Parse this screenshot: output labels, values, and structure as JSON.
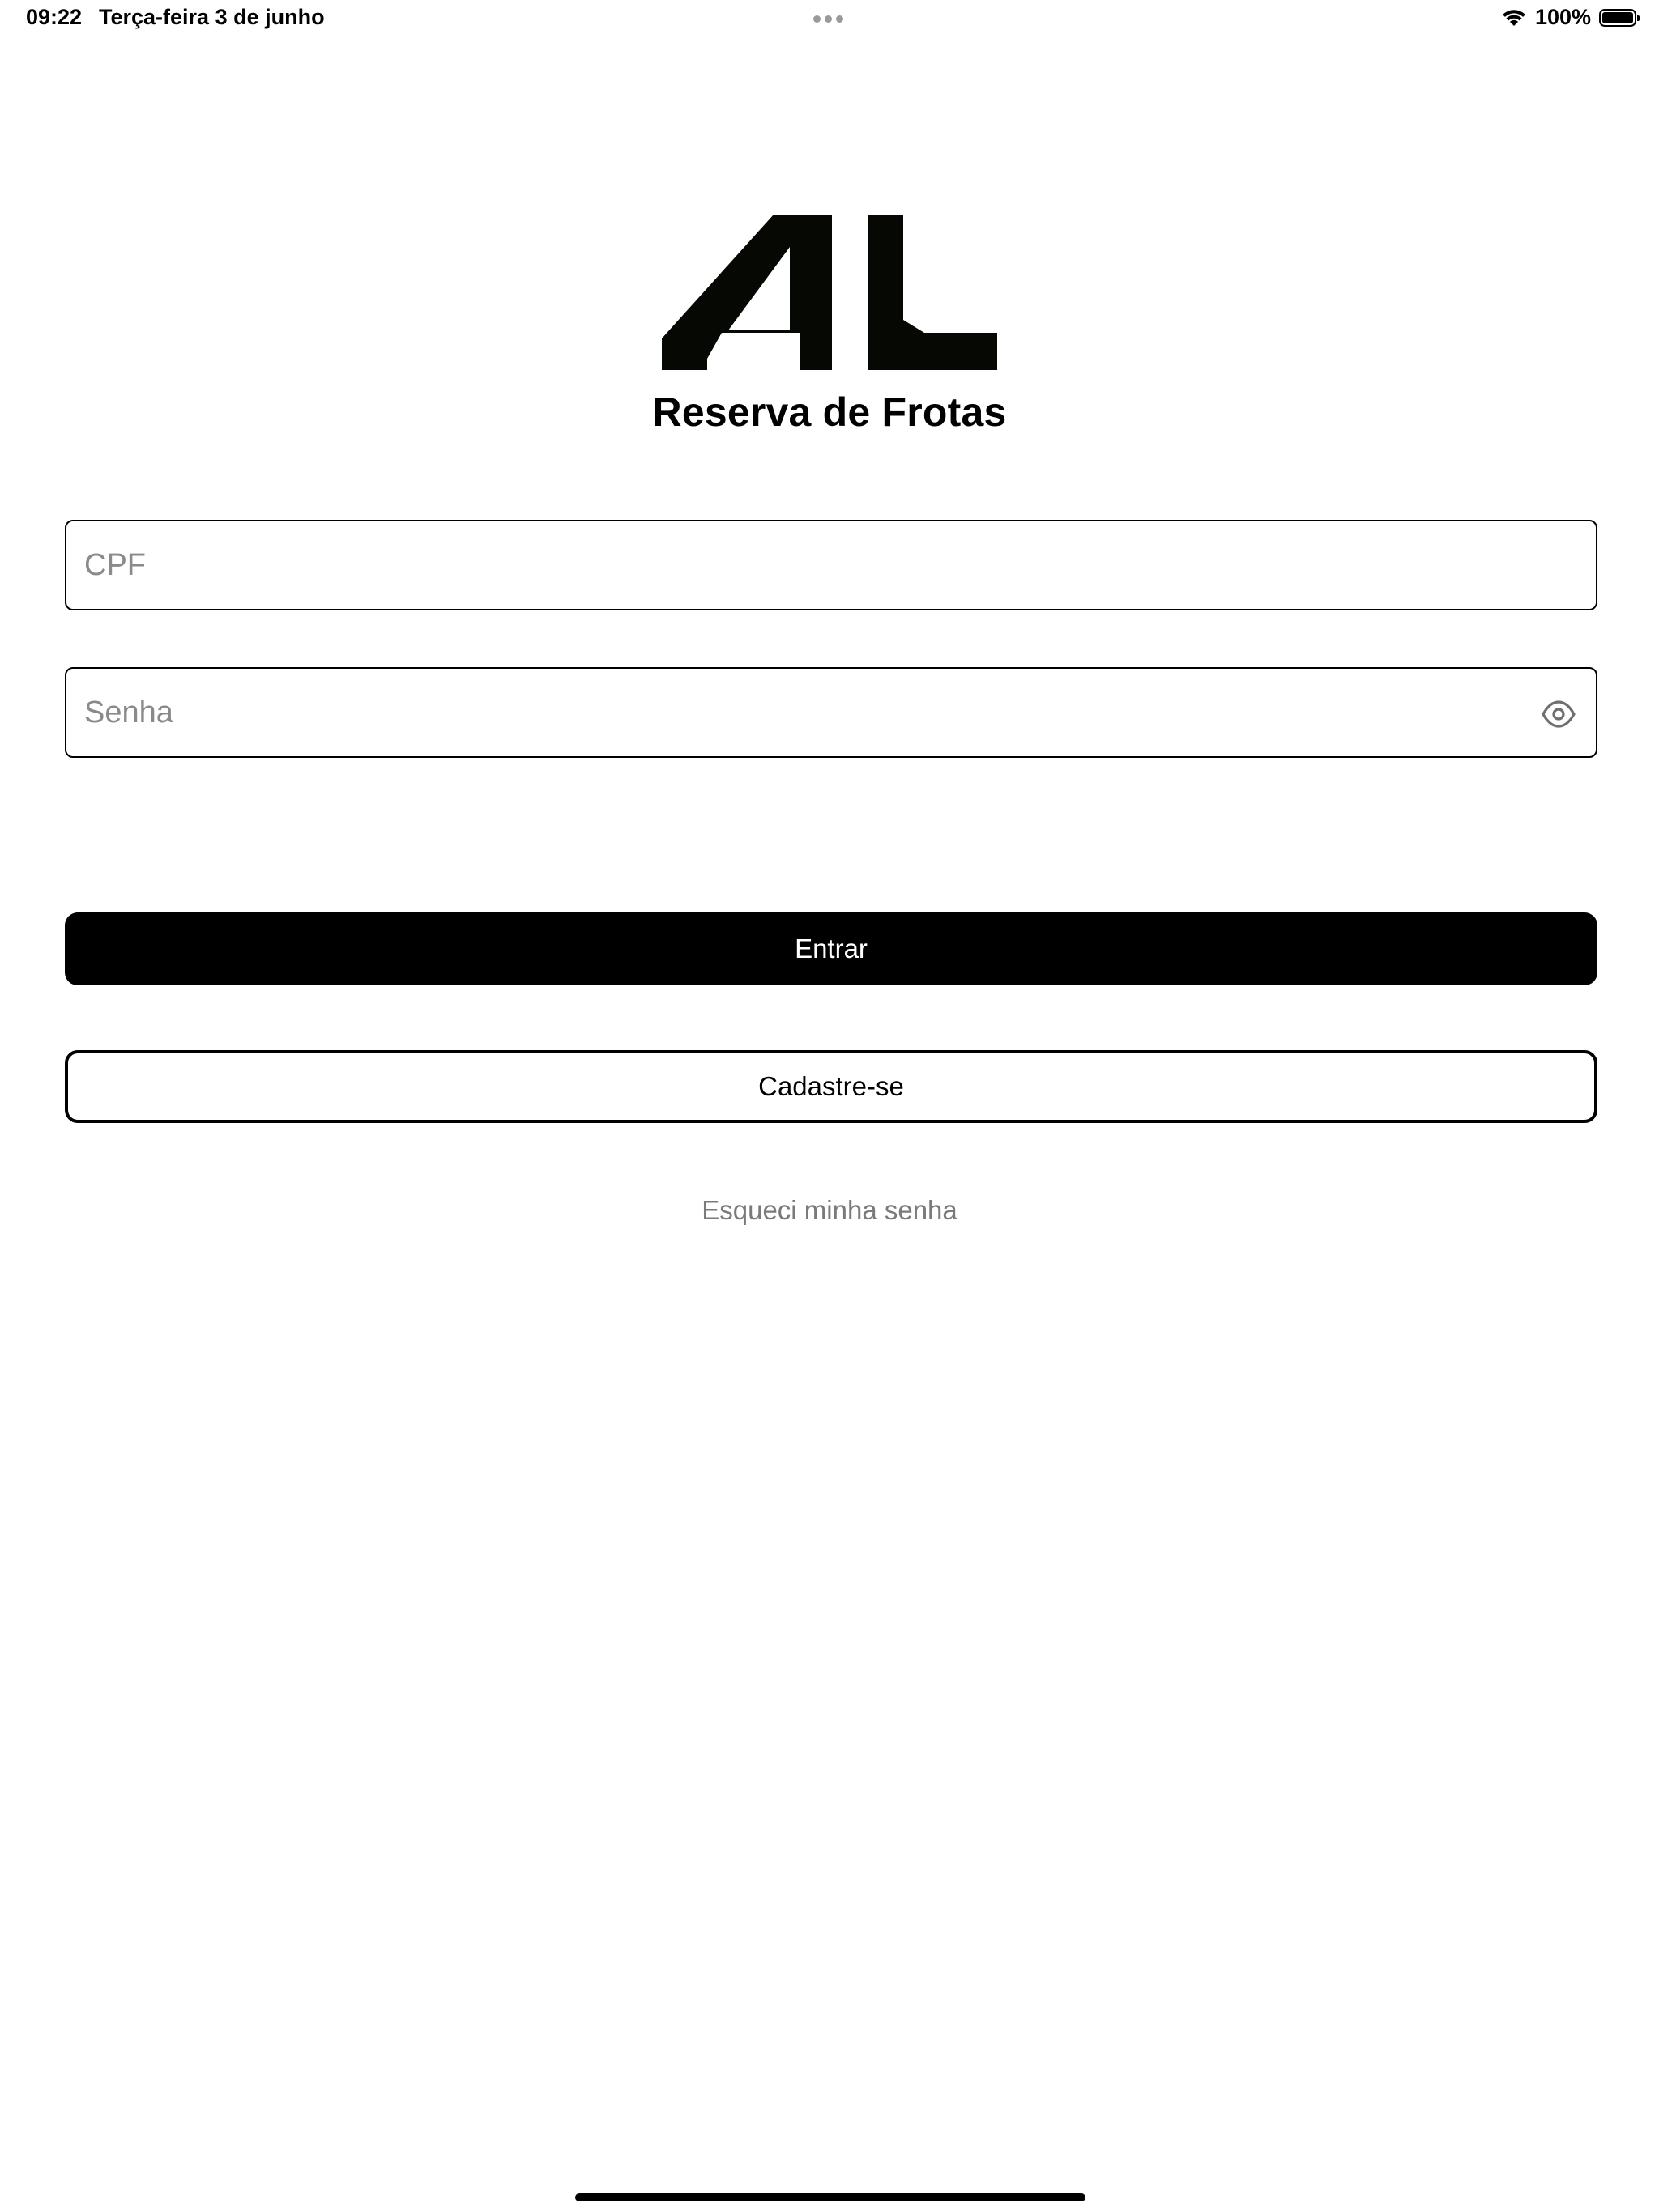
{
  "status_bar": {
    "time": "09:22",
    "date": "Terça-feira 3 de junho",
    "battery": "100%"
  },
  "brand": {
    "logo_text": "AL",
    "logo_color": "#060803",
    "app_title": "Reserva de Frotas"
  },
  "form": {
    "cpf": {
      "placeholder": "CPF",
      "value": ""
    },
    "senha": {
      "placeholder": "Senha",
      "value": ""
    }
  },
  "actions": {
    "login_label": "Entrar",
    "register_label": "Cadastre-se",
    "forgot_password_label": "Esqueci minha senha"
  },
  "icons": {
    "password_toggle": "eye-icon",
    "wifi": "wifi-icon",
    "battery": "battery-icon",
    "multitasking": "more-dots-icon"
  },
  "colors": {
    "primary": "#000000",
    "background": "#ffffff",
    "placeholder": "#8a8a8a",
    "link": "#7a7a7a"
  }
}
